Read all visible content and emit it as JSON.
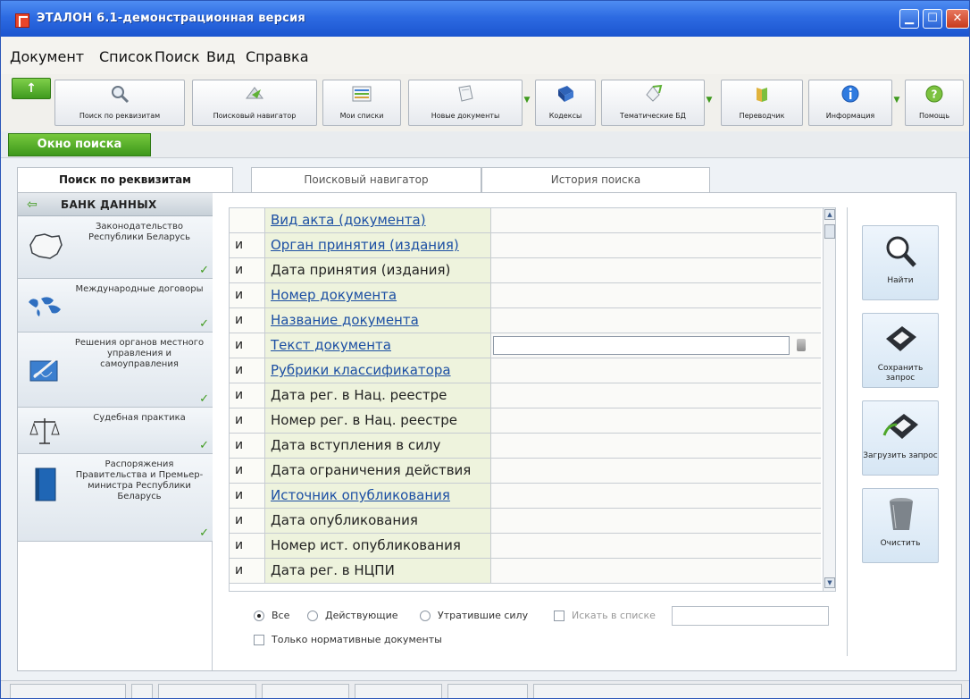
{
  "window": {
    "title": "ЭТАЛОН 6.1-демонстрационная версия",
    "minimize_symbol": "▁",
    "maximize_symbol": "☐",
    "close_symbol": "✕"
  },
  "menu": [
    "Документ",
    "Список",
    "Поиск",
    "Вид",
    "Справка"
  ],
  "toolbar": {
    "up_symbol": "↑",
    "buttons": [
      {
        "label": "Поиск по реквизитам",
        "icon": "magnifier-icon"
      },
      {
        "label": "Поисковый навигатор",
        "icon": "navigator-icon"
      },
      {
        "label": "Мои списки",
        "icon": "list-icon"
      },
      {
        "label": "Новые документы",
        "icon": "new-documents-icon"
      },
      {
        "label": "Кодексы",
        "icon": "book-icon"
      },
      {
        "label": "Тематические БД",
        "icon": "thematic-db-icon"
      },
      {
        "label": "Переводчик",
        "icon": "translator-icon"
      },
      {
        "label": "Информация",
        "icon": "info-icon"
      },
      {
        "label": "Помощь",
        "icon": "help-icon"
      }
    ],
    "dropdown_symbol": "▼"
  },
  "search_window_tab": "Окно поиска",
  "tabs": [
    {
      "label": "Поиск по реквизитам",
      "active": true
    },
    {
      "label": "Поисковый навигатор",
      "active": false
    },
    {
      "label": "История поиска",
      "active": false
    }
  ],
  "data_bank": {
    "title": "БАНК ДАННЫХ",
    "back_symbol": "⇦",
    "check_symbol": "✓",
    "items": [
      {
        "label": "Законодательство Республики Беларусь",
        "icon": "belarus-map-icon",
        "checked": true
      },
      {
        "label": "Международные договоры",
        "icon": "world-map-icon",
        "checked": true
      },
      {
        "label": "Решения органов местного управления и самоуправления",
        "icon": "signing-pen-icon",
        "checked": true
      },
      {
        "label": "Судебная практика",
        "icon": "scales-icon",
        "checked": true
      },
      {
        "label": "Распоряжения Правительства и Премьер-министра Республики Беларусь",
        "icon": "blue-book-icon",
        "checked": true
      }
    ]
  },
  "fields": [
    {
      "op": "",
      "name": "Вид акта (документа)",
      "link": true,
      "input": false
    },
    {
      "op": "и",
      "name": "Орган принятия (издания)",
      "link": true,
      "input": false
    },
    {
      "op": "и",
      "name": "Дата принятия (издания)",
      "link": false,
      "input": false
    },
    {
      "op": "и",
      "name": "Номер документа",
      "link": true,
      "input": false
    },
    {
      "op": "и",
      "name": "Название документа",
      "link": true,
      "input": false
    },
    {
      "op": "и",
      "name": "Текст документа",
      "link": true,
      "input": true
    },
    {
      "op": "и",
      "name": "Рубрики классификатора",
      "link": true,
      "input": false
    },
    {
      "op": "и",
      "name": "Дата рег. в Нац. реестре",
      "link": false,
      "input": false
    },
    {
      "op": "и",
      "name": "Номер рег. в Нац. реестре",
      "link": false,
      "input": false
    },
    {
      "op": "и",
      "name": "Дата вступления в силу",
      "link": false,
      "input": false
    },
    {
      "op": "и",
      "name": "Дата ограничения действия",
      "link": false,
      "input": false
    },
    {
      "op": "и",
      "name": "Источник опубликования",
      "link": true,
      "input": false
    },
    {
      "op": "и",
      "name": "Дата опубликования",
      "link": false,
      "input": false
    },
    {
      "op": "и",
      "name": "Номер ист. опубликования",
      "link": false,
      "input": false
    },
    {
      "op": "и",
      "name": "Дата рег. в НЦПИ",
      "link": false,
      "input": false
    }
  ],
  "scroll": {
    "up_symbol": "▲",
    "down_symbol": "▼"
  },
  "filters": {
    "status_options": [
      {
        "label": "Все",
        "selected": true
      },
      {
        "label": "Действующие",
        "selected": false
      },
      {
        "label": "Утратившие силу",
        "selected": false
      }
    ],
    "search_in_list": {
      "label": "Искать в списке",
      "checked": false,
      "value": ""
    },
    "normative_only": {
      "label": "Только нормативные документы",
      "checked": false
    }
  },
  "actions": [
    {
      "label": "Найти",
      "icon": "magnifier-icon"
    },
    {
      "label": "Сохранить запрос",
      "icon": "floppy-save-icon"
    },
    {
      "label": "Загрузить запрос",
      "icon": "floppy-load-icon"
    },
    {
      "label": "Очистить",
      "icon": "trash-bin-icon"
    }
  ],
  "colors": {
    "titlebar": "#2d6be2",
    "accent_green": "#3f9a1e",
    "link": "#1c4fa3",
    "field_name_bg": "#eef3dd"
  }
}
